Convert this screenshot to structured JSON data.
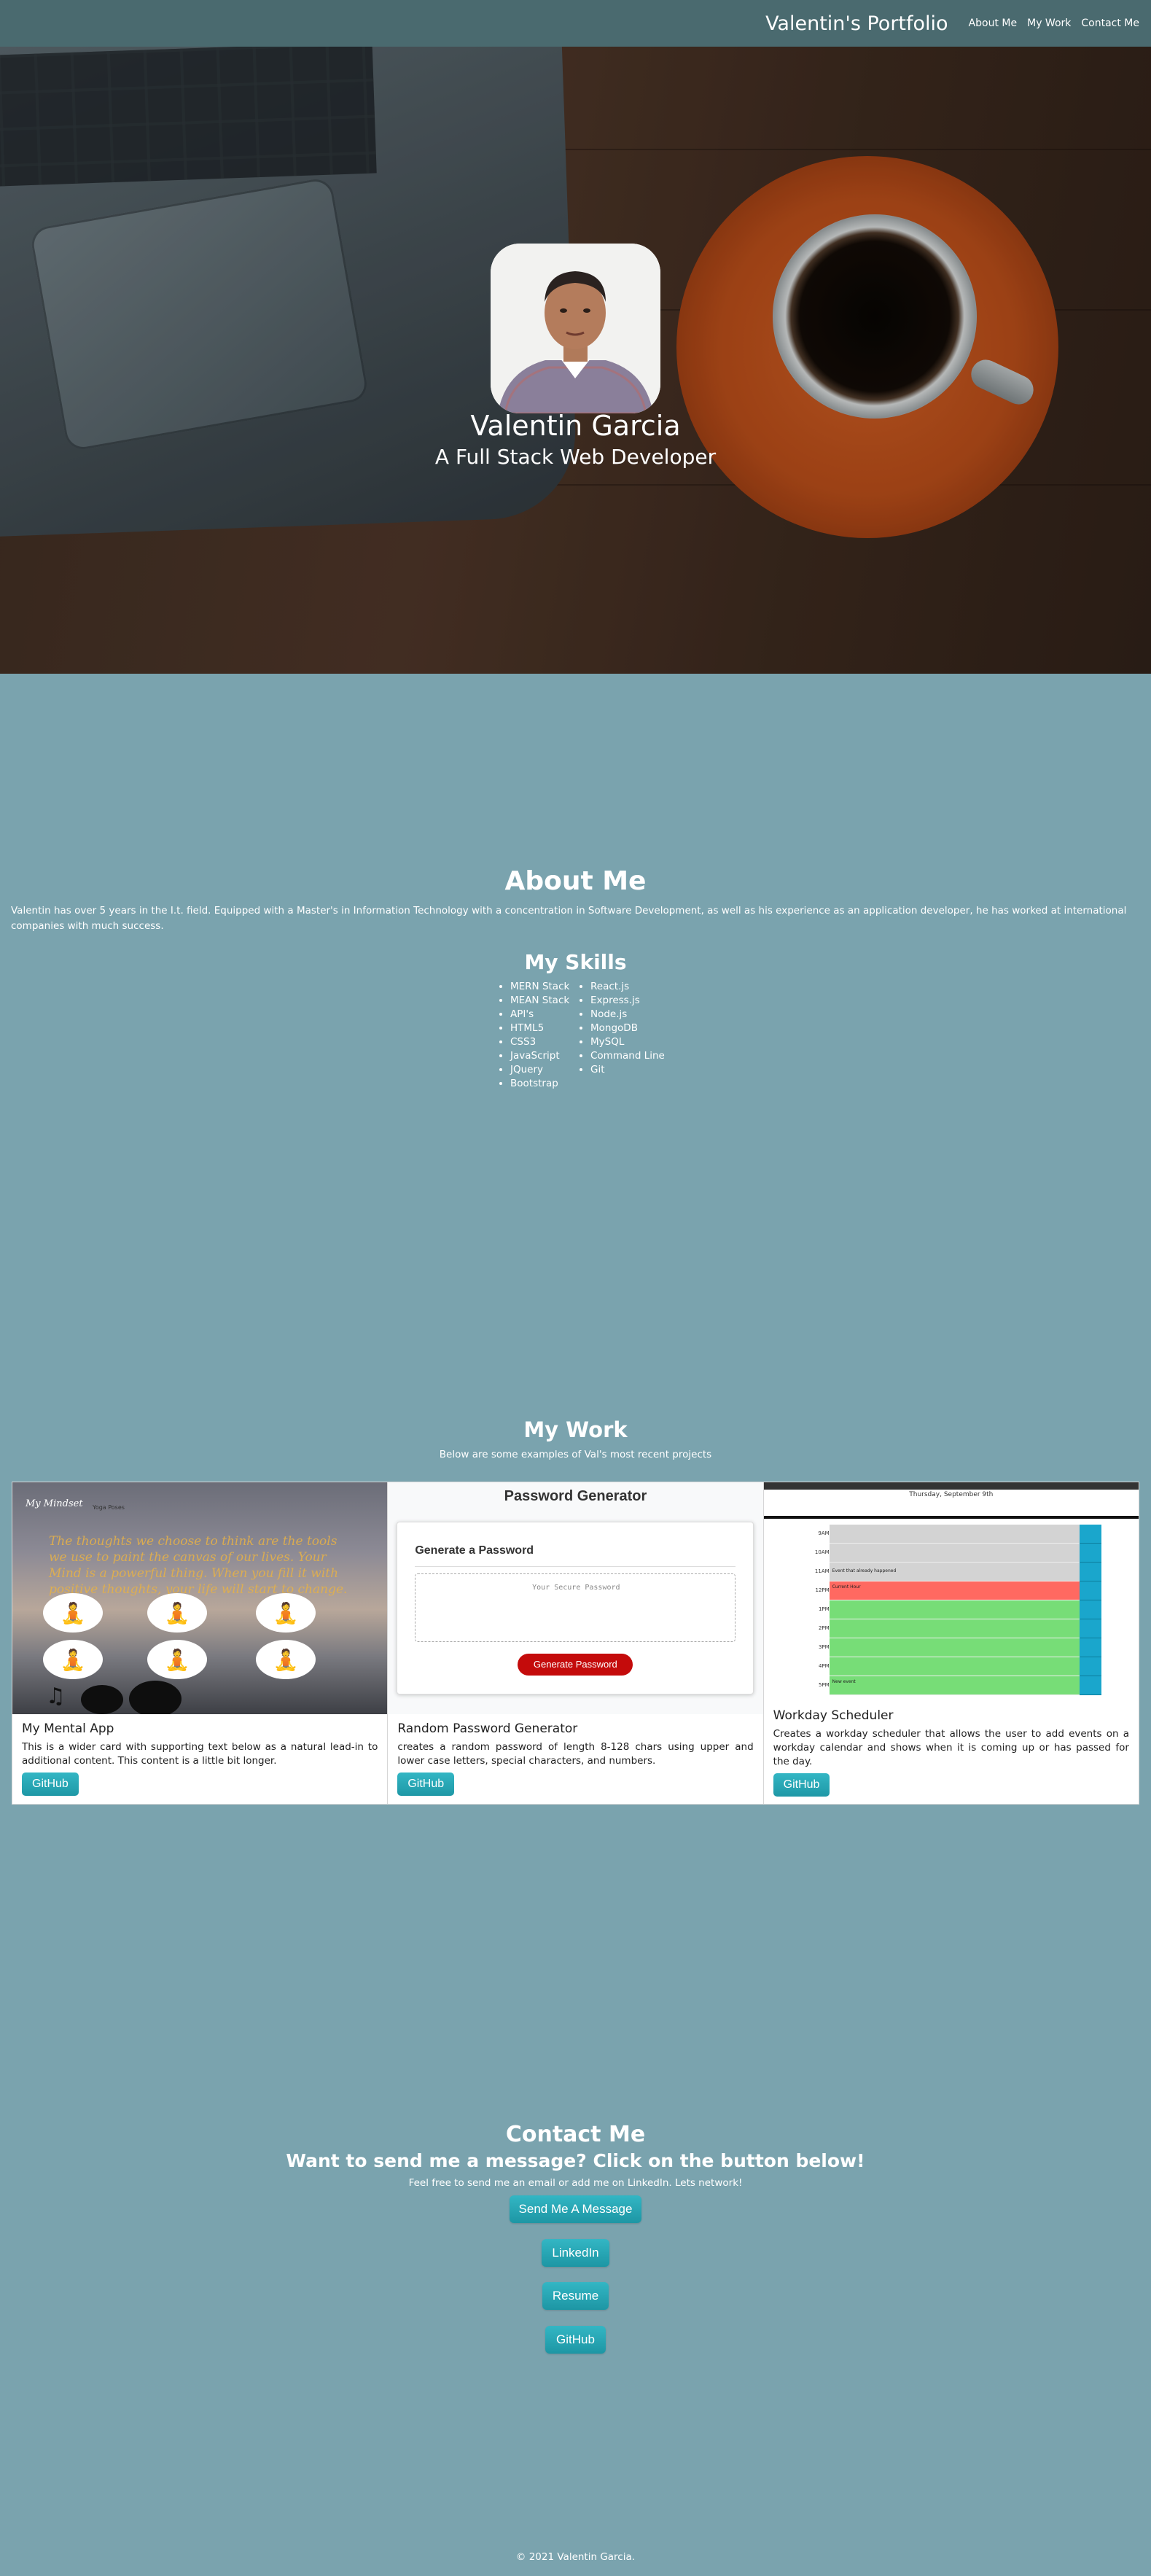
{
  "nav": {
    "brand": "Valentin's Portfolio",
    "links": [
      "About Me",
      "My Work",
      "Contact Me"
    ]
  },
  "hero": {
    "name": "Valentin Garcia",
    "title": "A Full Stack Web Developer"
  },
  "about": {
    "title": "About Me",
    "text": "Valentin has over 5 years in the I.t. field. Equipped with a Master's in Information Technology with a concentration in Software Development, as well as his experience as an application developer, he has worked at international companies with much success."
  },
  "skills": {
    "title": "My Skills",
    "col1": [
      "MERN Stack",
      "MEAN Stack",
      "API's",
      "HTML5",
      "CSS3",
      "JavaScript",
      "JQuery",
      "Bootstrap"
    ],
    "col2": [
      "React.js",
      "Express.js",
      "Node.js",
      "MongoDB",
      "MySQL",
      "Command Line",
      "Git"
    ]
  },
  "work": {
    "title": "My Work",
    "subtitle": "Below are some examples of Val's most recent projects",
    "cards": [
      {
        "title": "My Mental App",
        "text": "This is a wider card with supporting text below as a natural lead-in to additional content. This content is a little bit longer.",
        "button": "GitHub",
        "preview": {
          "logo": "My Mindset",
          "nav": "Yoga Poses",
          "quote": "The thoughts we choose to think are the tools we use to paint the canvas of our lives. Your Mind is a powerful thing. When you fill it with positive thoughts, your life will start to change."
        }
      },
      {
        "title": "Random Password Generator",
        "text": "creates a random password of length 8-128 chars using upper and lower case letters, special characters, and numbers.",
        "button": "GitHub",
        "preview": {
          "heading": "Password Generator",
          "card_heading": "Generate a Password",
          "placeholder": "Your Secure Password",
          "button": "Generate Password"
        }
      },
      {
        "title": "Workday Scheduler",
        "text": "Creates a workday scheduler that allows the user to add events on a workday calendar and shows when it is coming up or has passed for the day.",
        "button": "GitHub",
        "preview": {
          "date": "Thursday, September 9th",
          "hours": [
            "9AM",
            "10AM",
            "11AM",
            "12PM",
            "1PM",
            "2PM",
            "3PM",
            "4PM",
            "5PM"
          ],
          "events": [
            "Event that already happened",
            "Current Hour",
            "New event"
          ],
          "colors": {
            "past": "#d3d3d3",
            "present": "#ff6961",
            "future": "#77dd77",
            "save": "#06aed5"
          }
        }
      }
    ]
  },
  "contact": {
    "title": "Contact Me",
    "subtitle": "Want to send me a message? Click on the button below!",
    "note": "Feel free to send me an email or add me on LinkedIn. Lets network!",
    "buttons": [
      "Send Me A Message",
      "LinkedIn",
      "Resume",
      "GitHub"
    ]
  },
  "footer": "© 2021 Valentin Garcia.",
  "colors": {
    "page_bg": "#7aa3ae",
    "navbar": "#4a6a6f",
    "button": "#2aa9b7"
  }
}
